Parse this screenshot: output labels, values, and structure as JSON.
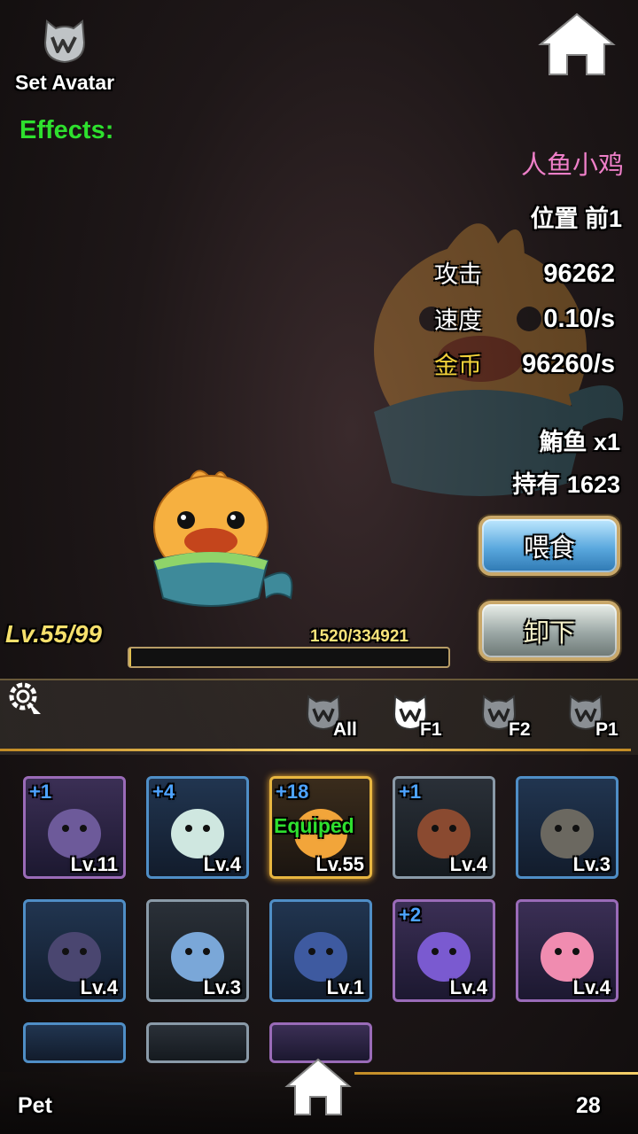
{
  "header": {
    "set_avatar_label": "Set Avatar",
    "effects_label": "Effects:"
  },
  "pet": {
    "name": "人鱼小鸡",
    "position_label": "位置",
    "position_value": "前1",
    "stats": [
      {
        "label": "攻击",
        "value": "96262"
      },
      {
        "label": "速度",
        "value": "0.10/s"
      },
      {
        "label": "金币",
        "value": "96260/s"
      }
    ],
    "food_label": "鮪鱼",
    "food_value": "x1",
    "owned_label": "持有",
    "owned_value": "1623",
    "level_text": "Lv.55",
    "level_max": "/99",
    "xp_text": "1520/334921",
    "xp_fraction": 0.0045
  },
  "buttons": {
    "feed": "喂食",
    "unequip": "卸下"
  },
  "tabs": [
    "All",
    "F1",
    "F2",
    "P1"
  ],
  "cards": [
    {
      "plus": "+1",
      "level": "Lv.11",
      "equipped": "",
      "border": "purple",
      "color": "#6d5a9a"
    },
    {
      "plus": "+4",
      "level": "Lv.4",
      "equipped": "",
      "border": "blue",
      "color": "#cfe7e0"
    },
    {
      "plus": "+18",
      "level": "Lv.55",
      "equipped": "Equiped",
      "border": "gold",
      "color": "#f2a53a"
    },
    {
      "plus": "+1",
      "level": "Lv.4",
      "equipped": "",
      "border": "gray",
      "color": "#8a4a30"
    },
    {
      "plus": "",
      "level": "Lv.3",
      "equipped": "",
      "border": "blue",
      "color": "#6b6860"
    },
    {
      "plus": "",
      "level": "Lv.4",
      "equipped": "",
      "border": "blue",
      "color": "#4a4670"
    },
    {
      "plus": "",
      "level": "Lv.3",
      "equipped": "",
      "border": "gray",
      "color": "#7aa7d8"
    },
    {
      "plus": "",
      "level": "Lv.1",
      "equipped": "",
      "border": "blue",
      "color": "#3e5aa0"
    },
    {
      "plus": "+2",
      "level": "Lv.4",
      "equipped": "",
      "border": "purple",
      "color": "#7a5ad0"
    },
    {
      "plus": "",
      "level": "Lv.4",
      "equipped": "",
      "border": "purple",
      "color": "#f08cb0"
    }
  ],
  "footer": {
    "label": "Pet",
    "count": "28"
  },
  "colors": {
    "accent_gold": "#e8b640",
    "effects_green": "#2ee02e",
    "name_pink": "#ee7fc8",
    "coin_yellow": "#f3d23a"
  }
}
